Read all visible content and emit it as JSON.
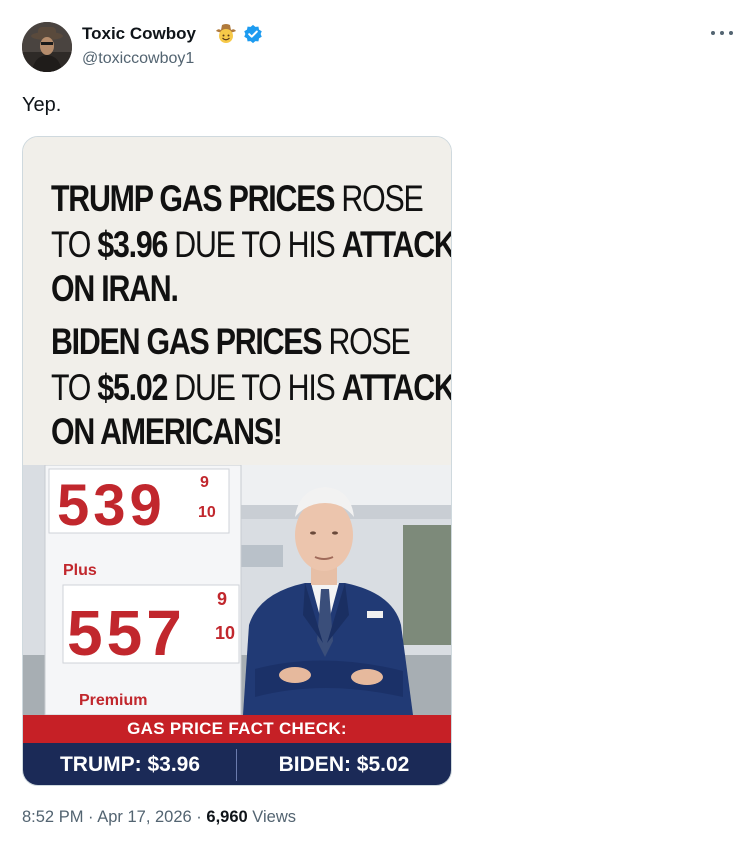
{
  "author": {
    "name": "Toxic Cowboy",
    "handle": "@toxiccowboy1",
    "emoji": "cowboy-hat-face-icon",
    "verified": true,
    "verified_color": "#1d9bf0"
  },
  "tweet": {
    "text": "Yep."
  },
  "media": {
    "headline": {
      "l1_bold": "TRUMP GAS PRICES",
      "l1_rest": " ROSE",
      "l2_pre": "TO ",
      "l2_bold": "$3.96",
      "l2_mid": " DUE TO HIS ",
      "l2_bold2": "ATTACK",
      "l3": "ON IRAN.",
      "l4_bold": "BIDEN GAS PRICES",
      "l4_rest": " ROSE",
      "l5_pre": "TO ",
      "l5_bold": "$5.02",
      "l5_mid": " DUE TO HIS ",
      "l5_bold2": "ATTACK",
      "l6": "ON AMERICANS!"
    },
    "sign": {
      "price1": "539",
      "price1_frac_top": "9",
      "price1_frac_bottom": "10",
      "label_plus": "Plus",
      "price2": "557",
      "price2_frac_top": "9",
      "price2_frac_bottom": "10",
      "label_premium": "Premium"
    },
    "banner": {
      "title": "GAS PRICE FACT CHECK:",
      "left": "TRUMP: $3.96",
      "right": "BIDEN: $5.02",
      "red": "#c62026",
      "blue": "#1b2a57"
    }
  },
  "footer": {
    "time": "8:52 PM",
    "sep1": " · ",
    "date": "Apr 17, 2026",
    "sep2": " · ",
    "views": "6,960",
    "views_label": " Views"
  }
}
